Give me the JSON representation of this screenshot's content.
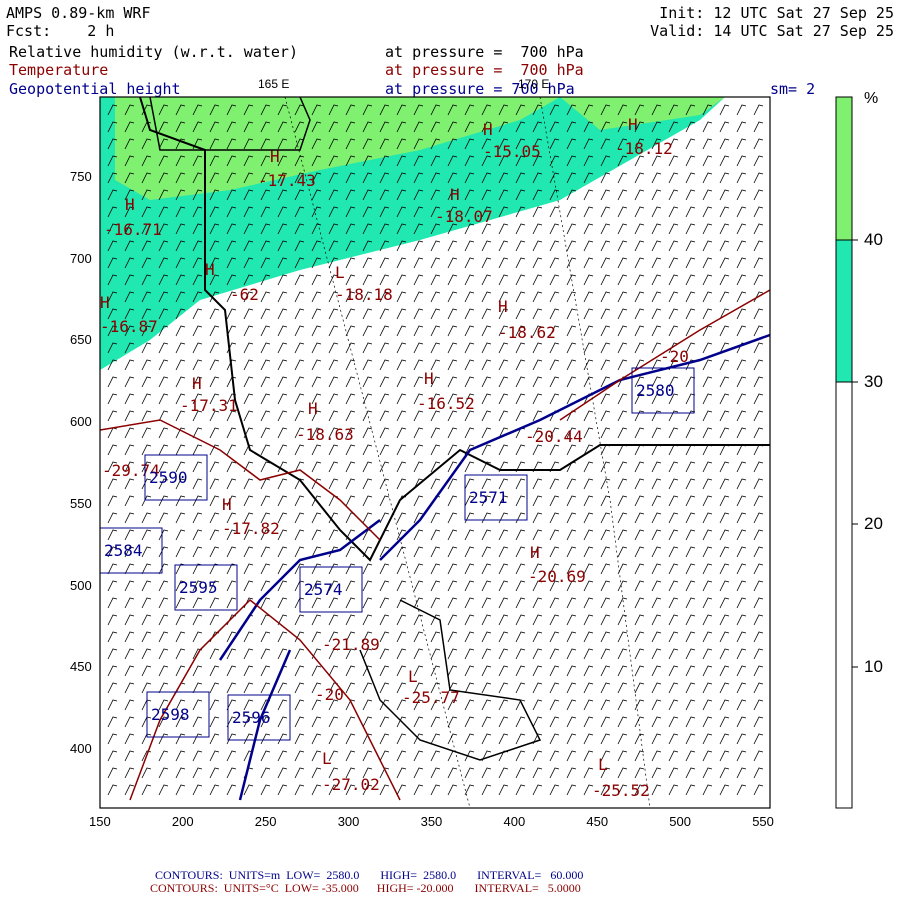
{
  "header": {
    "model": "AMPS 0.89-km WRF",
    "fcst": "Fcst:    2 h",
    "init": "Init: 12 UTC Sat 27 Sep 25",
    "valid": "Valid: 14 UTC Sat 27 Sep 25",
    "rh_label": "Relative humidity (w.r.t. water)",
    "rh_level": "at pressure =  700 hPa",
    "t_label": "Temperature",
    "t_level": "at pressure =  700 hPa",
    "z_label": "Geopotential height",
    "z_level": "at pressure = 700 hPa",
    "sm": "sm= 2",
    "lon1": "165 E",
    "lon2": "170 E"
  },
  "colorbar": {
    "unit": "%",
    "ticks": [
      "40",
      "30",
      "20",
      "10"
    ],
    "colors": [
      "#80f070",
      "#20e8b0",
      "#ffffff"
    ]
  },
  "axes": {
    "x": [
      "150",
      "200",
      "250",
      "300",
      "350",
      "400",
      "450",
      "500",
      "550"
    ],
    "y": [
      "750",
      "700",
      "650",
      "600",
      "550",
      "500",
      "450",
      "400"
    ]
  },
  "labels": {
    "temp": [
      "H",
      "-15.05",
      "H",
      "-18.12",
      "H",
      "-17.43",
      "H",
      "-18.07",
      "H",
      "-16.71",
      "H",
      "-62",
      "L",
      "-18.18",
      "H",
      "-16.87",
      "H",
      "-18.62",
      "H",
      "-17.31",
      "H",
      "-16.52",
      "H",
      "-18.63",
      "-20.44",
      "-20",
      "H",
      "-17.82",
      "H",
      "-20.69",
      "-21.89",
      "-20",
      "L",
      "-25.77",
      "L",
      "-27.02",
      "L",
      "-25.52",
      "-29.74"
    ],
    "height": [
      "2580",
      "2590",
      "2571",
      "2584",
      "2595",
      "2574",
      "2598",
      "2596"
    ]
  },
  "footer": {
    "line1": "CONTOURS:  UNITS=m  LOW=  2580.0       HIGH=  2580.0       INTERVAL=   60.000",
    "line2": "CONTOURS:  UNITS=°C  LOW= -35.000      HIGH= -20.000       INTERVAL=   5.0000"
  }
}
